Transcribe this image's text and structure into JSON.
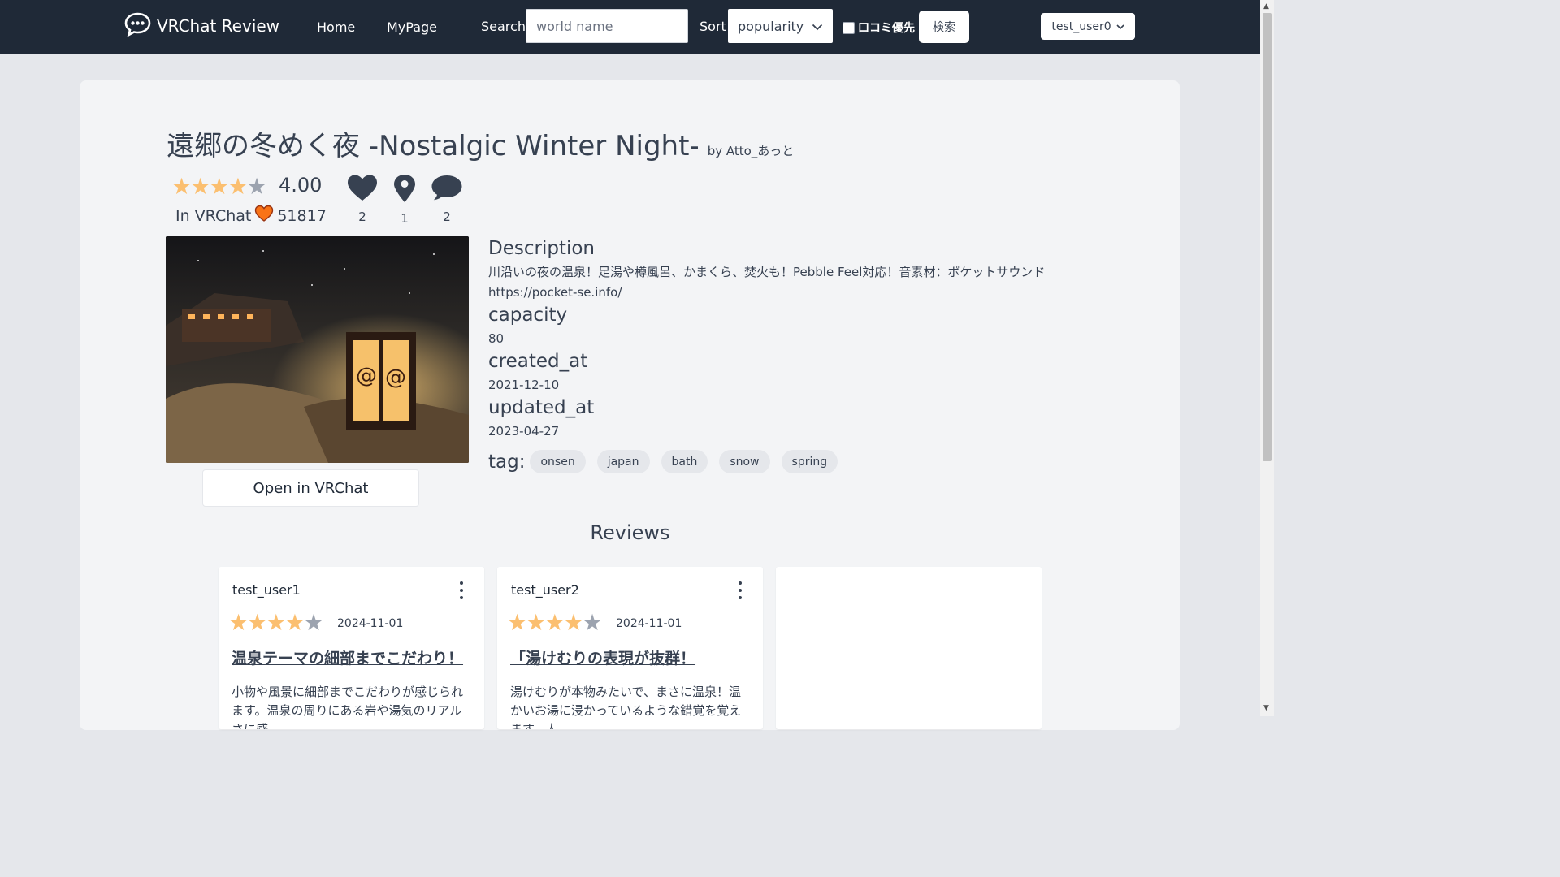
{
  "nav": {
    "brand": "VRChat Review",
    "links": [
      "Home",
      "MyPage"
    ],
    "search_label": "Search",
    "search_placeholder": "world name",
    "sort_label": "Sort",
    "sort_value": "popularity",
    "checkbox_label": "口コミ優先",
    "search_button": "検索",
    "user": "test_user0"
  },
  "world": {
    "title": "遠郷の冬めく夜 -Nostalgic Winter Night-",
    "author": "by Atto_あっと",
    "rating": "4.00",
    "rating_stars": 4,
    "invr_label": "In VRChat",
    "invr_favorites": "51817",
    "stats": {
      "likes": "2",
      "visits": "1",
      "reviews": "2"
    },
    "open_button": "Open in VRChat",
    "description_heading": "Description",
    "description": "川沿いの夜の温泉！足湯や樽風呂、かまくら、焚火も！Pebble Feel対応！音素材：ポケットサウンド https://pocket-se.info/",
    "capacity_heading": "capacity",
    "capacity": "80",
    "created_heading": "created_at",
    "created_at": "2021-12-10",
    "updated_heading": "updated_at",
    "updated_at": "2023-04-27",
    "tag_heading": "tag:",
    "tags": [
      "onsen",
      "japan",
      "bath",
      "snow",
      "spring"
    ]
  },
  "reviews_heading": "Reviews",
  "reviews": [
    {
      "user": "test_user1",
      "stars": 4,
      "date": "2024-11-01",
      "title": "温泉テーマの細部までこだわり！",
      "body": "小物や風景に細部までこだわりが感じられます。温泉の周りにある岩や湯気のリアルさに感"
    },
    {
      "user": "test_user2",
      "stars": 4,
      "date": "2024-11-01",
      "title": "「湯けむりの表現が抜群！",
      "body": "湯けむりが本物みたいで、まさに温泉！温かいお湯に浸かっているような錯覚を覚えます。人"
    }
  ]
}
